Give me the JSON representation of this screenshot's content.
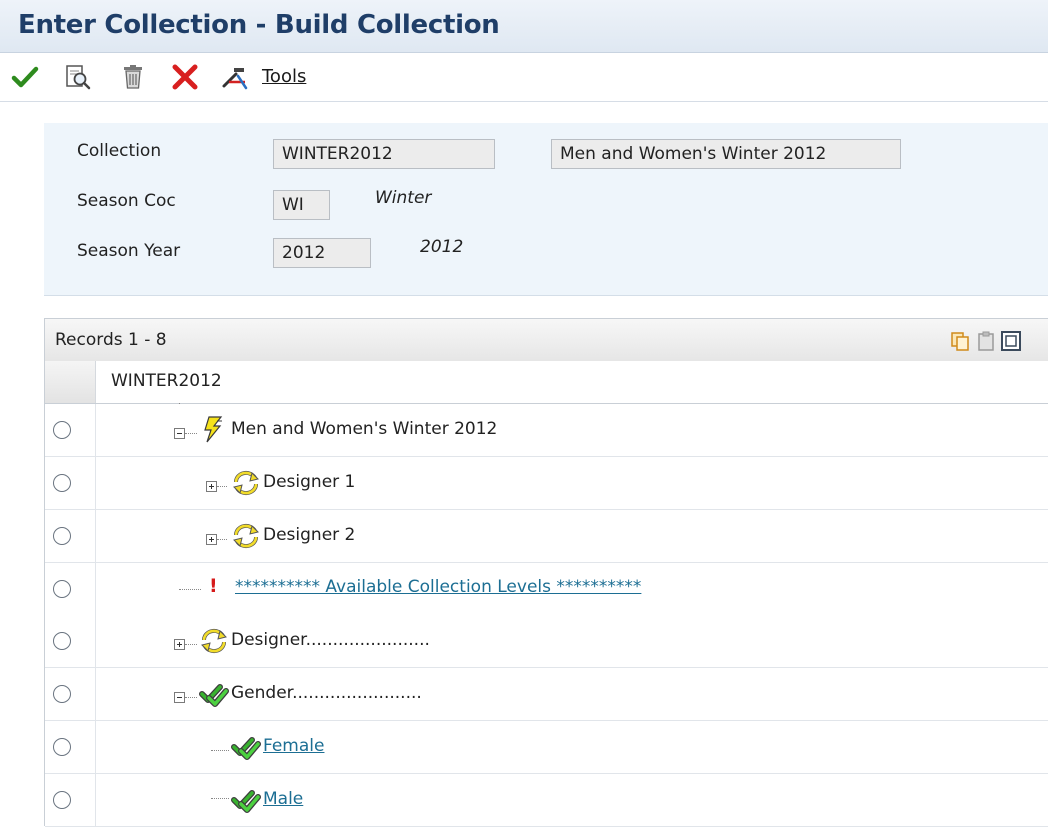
{
  "window": {
    "title": "Enter Collection - Build Collection"
  },
  "toolbar": {
    "ok_icon": "checkmark-icon",
    "find_icon": "find-icon",
    "delete_icon": "trash-icon",
    "cancel_icon": "close-icon",
    "tools_icon": "tools-icon",
    "tools_label": "Tools"
  },
  "header_form": {
    "collection": {
      "label": "Collection",
      "value": "WINTER2012",
      "description": "Men and Women's Winter 2012"
    },
    "season_code": {
      "label": "Season Coc",
      "value": "WI",
      "description": "Winter"
    },
    "season_year": {
      "label": "Season Year",
      "value": "2012",
      "description": "2012"
    }
  },
  "grid": {
    "records_label": "Records 1 - 8",
    "column_header": "WINTER2012",
    "rows": [
      {
        "label": "Men and Women's Winter 2012",
        "icon": "lightning-icon",
        "link": false
      },
      {
        "label": "Designer 1",
        "icon": "refresh-icon",
        "link": false
      },
      {
        "label": "Designer 2",
        "icon": "refresh-icon",
        "link": false
      },
      {
        "label": "********** Available Collection Levels **********",
        "icon": "exclamation-icon",
        "link": true
      },
      {
        "label": "Designer.......................",
        "icon": "refresh-icon",
        "link": false
      },
      {
        "label": "Gender........................",
        "icon": "multi-check-icon",
        "link": false
      },
      {
        "label": "Female",
        "icon": "multi-check-icon",
        "link": true
      },
      {
        "label": "Male",
        "icon": "multi-check-icon",
        "link": true
      }
    ]
  },
  "colors": {
    "title_text": "#1f3e68",
    "link": "#1c6e93",
    "header_panel_bg": "#eef5fb"
  }
}
